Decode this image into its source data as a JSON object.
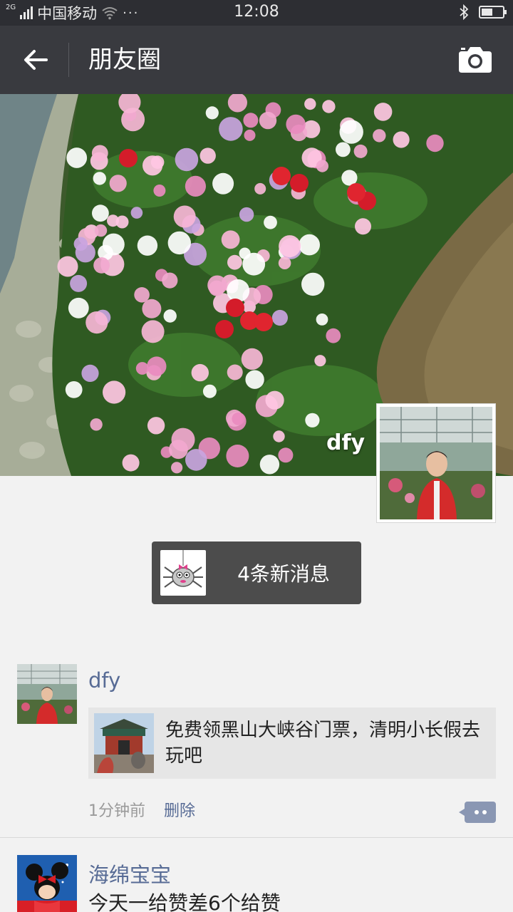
{
  "status_bar": {
    "network_type": "2G",
    "carrier": "中国移动",
    "more": "···",
    "time": "12:08",
    "battery_level": 0.55,
    "icons": [
      "signal-icon",
      "wifi-icon",
      "bluetooth-icon",
      "battery-icon"
    ]
  },
  "nav": {
    "title": "朋友圈",
    "back_icon": "arrow-left-icon",
    "camera_icon": "camera-icon"
  },
  "cover": {
    "username": "dfy"
  },
  "new_messages": {
    "label": "4条新消息"
  },
  "posts": [
    {
      "author": "dfy",
      "link_title": "免费领黑山大峡谷门票，清明小长假去玩吧",
      "time": "1分钟前",
      "delete_label": "删除"
    },
    {
      "author": "海绵宝宝",
      "text": "今天一给赞差6个给赞"
    }
  ],
  "colors": {
    "status_bar_bg": "#2d2e33",
    "nav_bg": "#393a3f",
    "link_name": "#576b95",
    "page_bg": "#f2f2f2"
  }
}
